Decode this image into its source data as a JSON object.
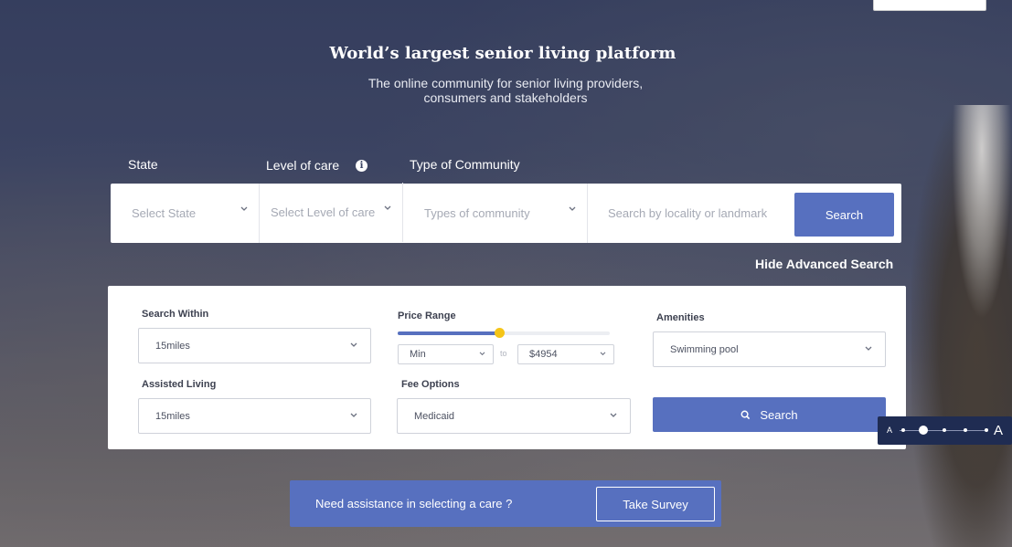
{
  "hero": {
    "title": "World’s largest senior living platform",
    "subtitle_line1": "The online community for senior living providers,",
    "subtitle_line2": "consumers and stakeholders"
  },
  "filters": {
    "state_label": "State",
    "care_label": "Level of care",
    "type_label": "Type of Community",
    "state_placeholder": "Select State",
    "care_placeholder": "Select Level of care",
    "type_placeholder": "Types of community",
    "search_placeholder": "Search by locality or landmark",
    "search_button": "Search"
  },
  "toggle_advanced": "Hide Advanced Search",
  "advanced": {
    "search_within_label": "Search Within",
    "search_within_value": "15miles",
    "price_range_label": "Price Range",
    "price_range_fill": 0.48,
    "price_min": "Min",
    "price_to": "to",
    "price_max": "$4954",
    "amenities_label": "Amenities",
    "amenities_value": "Swimming pool",
    "assisted_label": "Assisted Living",
    "assisted_value": "15miles",
    "fee_label": "Fee Options",
    "fee_value": "Medicaid",
    "search_button": "Search"
  },
  "font_size_control": {
    "small": "A",
    "large": "A",
    "level": 0.25
  },
  "survey": {
    "text": "Need assistance in selecting a care ?",
    "button": "Take Survey"
  },
  "colors": {
    "accent": "#5770bf",
    "slider_knob": "#f5c518",
    "font_control_bg": "#1f2c52"
  }
}
